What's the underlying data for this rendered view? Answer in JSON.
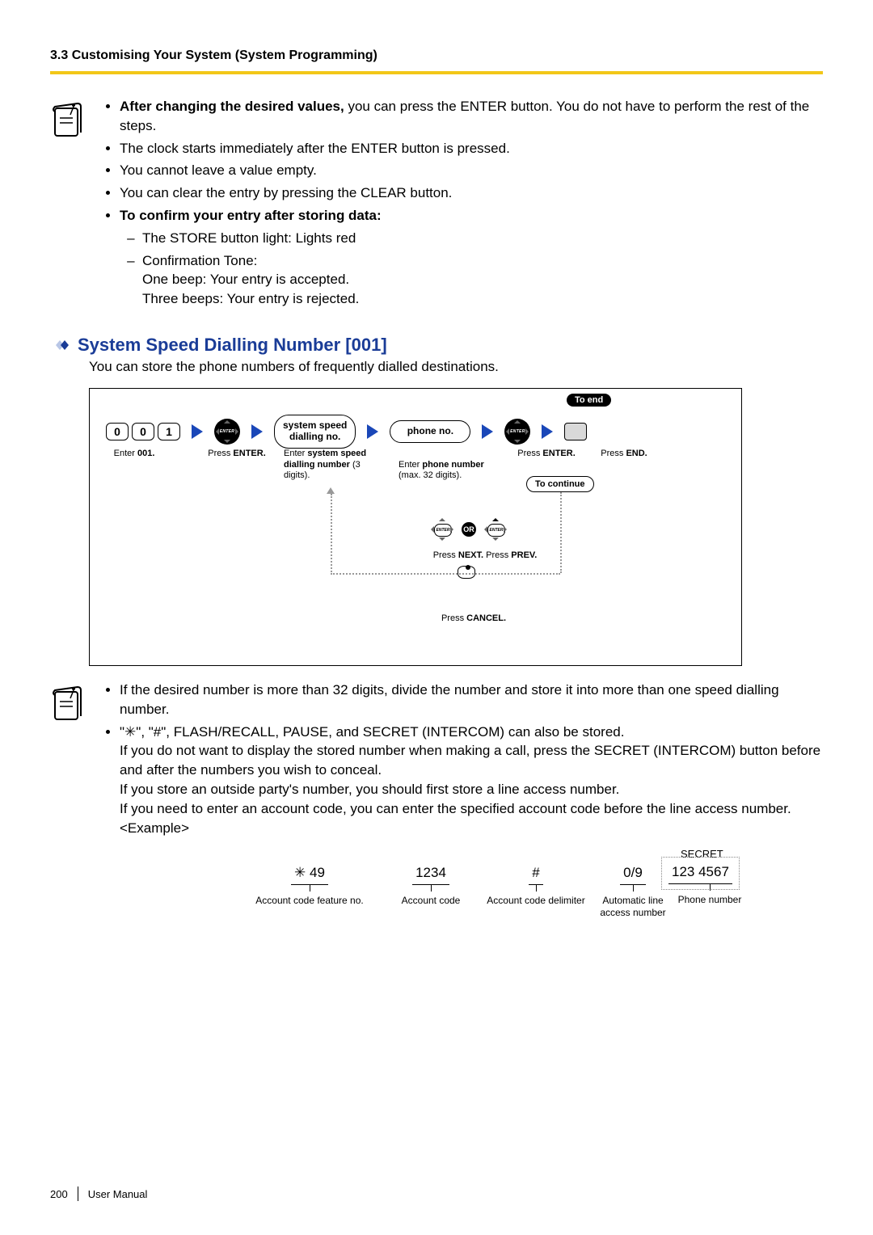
{
  "header": {
    "section_label": "3.3 Customising Your System (System Programming)"
  },
  "note1": {
    "lines": [
      {
        "bold": "After changing the desired values,",
        "rest": " you can press the ENTER button. You do not have to perform the rest of the steps."
      },
      {
        "rest": "The clock starts immediately after the ENTER button is pressed."
      },
      {
        "rest": "You cannot leave a value empty."
      },
      {
        "rest": "You can clear the entry by pressing the CLEAR button."
      },
      {
        "bold": "To confirm your entry after storing data:"
      }
    ],
    "confirm_sub": [
      "The STORE button light: Lights red",
      "Confirmation Tone:"
    ],
    "confirm_tone": {
      "one": "One beep: Your entry is accepted.",
      "three": "Three beeps: Your entry is rejected."
    }
  },
  "feature": {
    "title": "System Speed Dialling Number [001]",
    "desc": "You can store the phone numbers of frequently dialled destinations."
  },
  "flow": {
    "digits": [
      "0",
      "0",
      "1"
    ],
    "bubbles": {
      "ssd": "system speed\ndialling no.",
      "phone": "phone no."
    },
    "pill_toend": "To end",
    "pill_tocontinue": "To continue",
    "captions": {
      "enter001": {
        "p": "Enter ",
        "b": "001."
      },
      "press_enter1": {
        "p": "Press ",
        "b": "ENTER."
      },
      "enter_ssd": {
        "p1": "Enter ",
        "b1": "system speed dialling number",
        "p2": " (3 digits)."
      },
      "enter_phone": {
        "p1": "Enter ",
        "b1": "phone number",
        "p2": "\n(max. 32 digits)."
      },
      "press_enter2": {
        "p": "Press ",
        "b": "ENTER."
      },
      "press_end": {
        "p": "Press ",
        "b": "END."
      },
      "press_next": {
        "p": "Press ",
        "b": "NEXT."
      },
      "press_prev": {
        "p": " Press ",
        "b": "PREV."
      },
      "press_cancel": {
        "p": "Press ",
        "b": "CANCEL."
      }
    },
    "or": "OR"
  },
  "note2": {
    "lines": [
      "If the desired number is more than 32 digits, divide the number and store it into more than one speed dialling number.",
      "\"✳\", \"#\", FLASH/RECALL, PAUSE, and SECRET (INTERCOM) can also be stored.",
      "If you do not want to display the stored number when making a call, press the SECRET (INTERCOM) button before and after the numbers you wish to conceal.",
      "If you store an outside party's number, you should first store a line access number.",
      "If you need to enter an account code, you can enter the specified account code before the line access number.",
      "<Example>"
    ]
  },
  "example": {
    "secret_label": "SECRET",
    "cols": [
      {
        "val": "✳ 49",
        "lbl": "Account code feature no."
      },
      {
        "val": "1234",
        "lbl": "Account code"
      },
      {
        "val": "#",
        "lbl": "Account code delimiter"
      },
      {
        "val": "0/9",
        "lbl": "Automatic line\naccess number"
      },
      {
        "val": "123  4567",
        "lbl": "Phone number"
      }
    ]
  },
  "footer": {
    "page": "200",
    "label": "User Manual"
  }
}
